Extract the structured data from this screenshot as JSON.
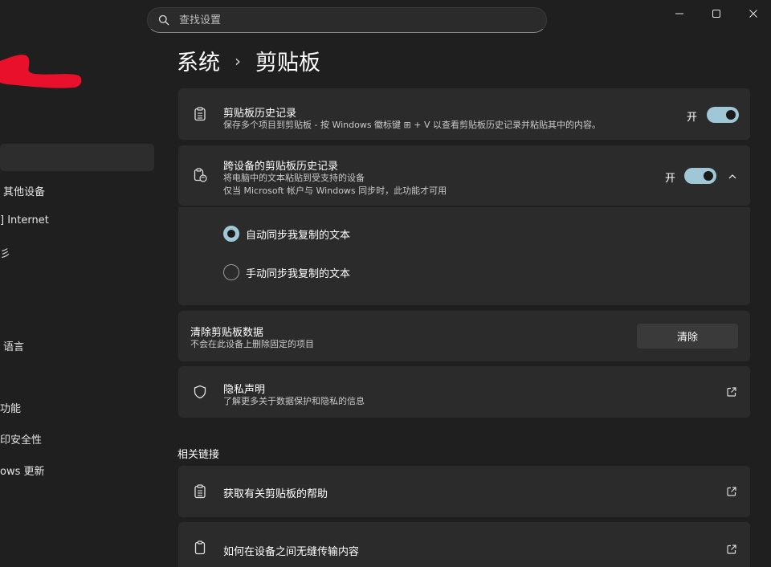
{
  "search": {
    "placeholder": "查找设置"
  },
  "nav": {
    "items": [
      "其他设备",
      "] Internet",
      "彡",
      "语言",
      "功能",
      "印安全性",
      "ows 更新"
    ]
  },
  "breadcrumb": {
    "parent": "系统",
    "separator": "›",
    "current": "剪贴板"
  },
  "clipboard_history": {
    "title": "剪贴板历史记录",
    "desc": "保存多个项目到剪贴板 - 按 Windows 徽标键 ⊞ + V 以查看剪贴板历史记录并粘贴其中的内容。",
    "toggle_label": "开"
  },
  "cross_device": {
    "title": "跨设备的剪贴板历史记录",
    "desc1": "将电脑中的文本粘贴到受支持的设备",
    "desc2": "仅当 Microsoft 帐户与 Windows 同步时，此功能才可用",
    "toggle_label": "开",
    "options": [
      "自动同步我复制的文本",
      "手动同步我复制的文本"
    ]
  },
  "clear_data": {
    "title": "清除剪贴板数据",
    "desc": "不会在此设备上删除固定的项目",
    "button": "清除"
  },
  "privacy": {
    "title": "隐私声明",
    "desc": "了解更多关于数据保护和隐私的信息"
  },
  "related": {
    "heading": "相关链接",
    "items": [
      "获取有关剪贴板的帮助",
      "如何在设备之间无缝传输内容"
    ]
  },
  "colors": {
    "accent": "#9fc7d6",
    "background": "#1f1f1f",
    "card": "#2b2b2b"
  }
}
